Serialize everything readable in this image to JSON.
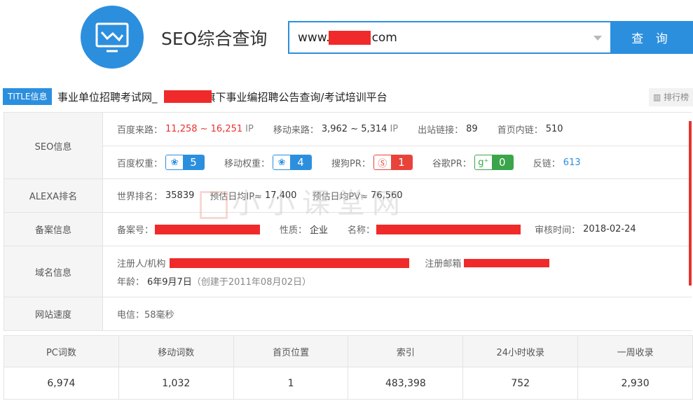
{
  "header": {
    "app_title": "SEO综合查询",
    "search_prefix": "www.",
    "search_suffix": "com",
    "search_button": "查 询"
  },
  "title_row": {
    "badge": "TITLE信息",
    "text_start": "事业单位招聘考试网_",
    "text_end": "旗下事业编招聘公告查询/考试培训平台",
    "rank_link": "排行榜"
  },
  "watermark": "小小课堂网",
  "seo": {
    "label": "SEO信息",
    "baidu_traffic_label": "百度来路：",
    "baidu_traffic_value": "11,258 ~ 16,251",
    "ip_unit": "IP",
    "mobile_traffic_label": "移动来路：",
    "mobile_traffic_value": "3,962 ~ 5,314",
    "outlinks_label": "出站链接：",
    "outlinks_value": "89",
    "inlinks_label": "首页内链：",
    "inlinks_value": "510",
    "baidu_weight_label": "百度权重：",
    "baidu_weight_value": "5",
    "mobile_weight_label": "移动权重：",
    "mobile_weight_value": "4",
    "sogou_pr_label": "搜狗PR：",
    "sogou_pr_value": "1",
    "google_pr_label": "谷歌PR：",
    "google_pr_value": "0",
    "backlinks_label": "反链：",
    "backlinks_value": "613"
  },
  "alexa": {
    "label": "ALEXA排名",
    "world_rank_label": "世界排名：",
    "world_rank_value": "35839",
    "daily_ip_label": "预估日均IP≈",
    "daily_ip_value": "17,400",
    "daily_pv_label": "预估日均PV≈",
    "daily_pv_value": "76,560"
  },
  "icp": {
    "label": "备案信息",
    "number_label": "备案号：",
    "nature_label": "性质：",
    "nature_value": "企业",
    "name_label": "名称：",
    "audit_label": "审核时间：",
    "audit_value": "2018-02-24"
  },
  "domain": {
    "label": "域名信息",
    "registrant_label": "注册人/机构",
    "email_label": "注册邮箱",
    "age_label": "年龄：",
    "age_value": "6年9月7日",
    "created_note": "（创建于2011年08月02日）"
  },
  "speed": {
    "label": "网站速度",
    "value": "电信：58毫秒"
  },
  "stats": {
    "headers": [
      "PC词数",
      "移动词数",
      "首页位置",
      "索引",
      "24小时收录",
      "一周收录"
    ],
    "values": [
      "6,974",
      "1,032",
      "1",
      "483,398",
      "752",
      "2,930"
    ]
  },
  "colors": {
    "accent": "#2c8fde",
    "highlight": "#e8322c",
    "google_green": "#3aa54a"
  }
}
